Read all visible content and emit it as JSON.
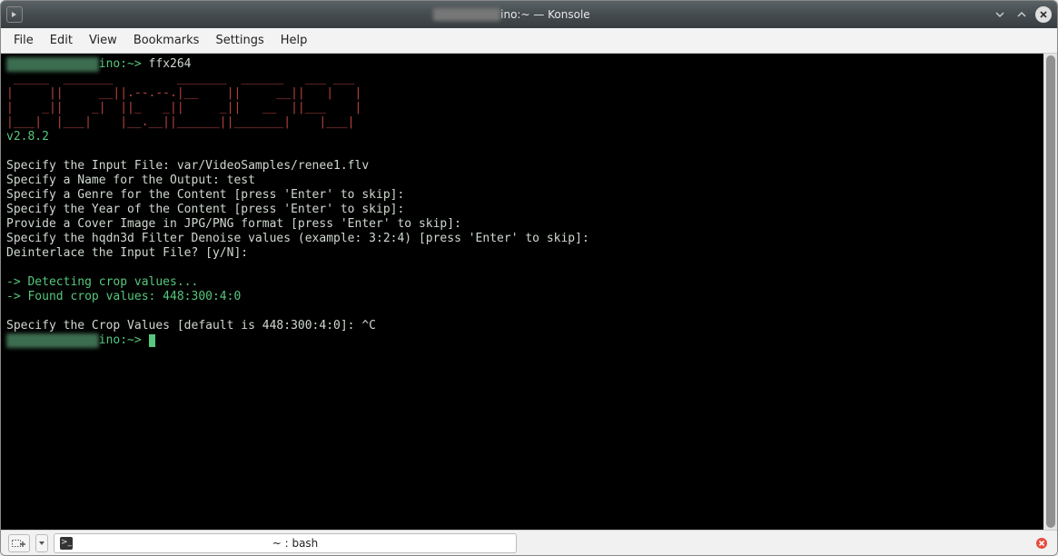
{
  "window": {
    "title_obscured": "████████",
    "title_suffix": "ino:~ — Konsole"
  },
  "menubar": {
    "items": [
      "File",
      "Edit",
      "View",
      "Bookmarks",
      "Settings",
      "Help"
    ]
  },
  "terminal": {
    "prompt_obscured": "█████████████",
    "prompt_suffix": "ino:~> ",
    "command": "ffx264",
    "ascii_art": " _____  _______         _______  ______   ___ ___\n|     ||     __||.--.--.|__    ||     __||   |   |\n|    _||    _|  ||_   _||     _||   __  ||___    |\n|___|  |___|    |__.__||______||_______|    |___|",
    "version": "v2.8.2",
    "lines": [
      "Specify the Input File: var/VideoSamples/renee1.flv",
      "Specify a Name for the Output: test",
      "Specify a Genre for the Content [press 'Enter' to skip]:",
      "Specify the Year of the Content [press 'Enter' to skip]:",
      "Provide a Cover Image in JPG/PNG format [press 'Enter' to skip]:",
      "Specify the hqdn3d Filter Denoise values (example: 3:2:4) [press 'Enter' to skip]:",
      "Deinterlace the Input File? [y/N]:"
    ],
    "detect1": "-> Detecting crop values...",
    "detect2": "-> Found crop values: 448:300:4:0",
    "crop_line": "Specify the Crop Values [default is 448:300:4:0]: ^C"
  },
  "bottombar": {
    "tab_label": "~ : bash"
  }
}
